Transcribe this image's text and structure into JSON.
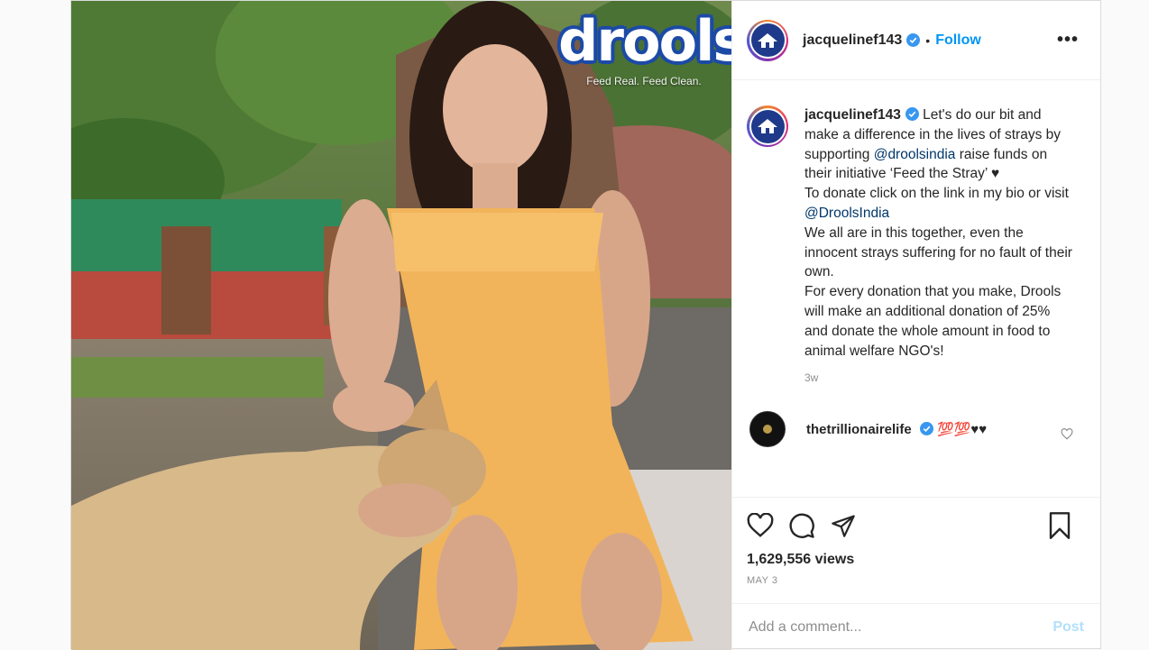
{
  "media": {
    "brand_name": "drools",
    "brand_tagline": "Feed Real. Feed Clean."
  },
  "header": {
    "username": "jacquelinef143",
    "dot": "•",
    "follow_label": "Follow",
    "more_label": "•••"
  },
  "caption": {
    "username": "jacquelinef143",
    "parts": {
      "p1": " Let's do our bit and make a difference in the lives of strays by supporting ",
      "mention1": "@droolsindia",
      "p2": " raise funds on their initiative ‘Feed the Stray’ ♥",
      "p3": "To donate click on the link in my bio or visit ",
      "mention2": "@DroolsIndia",
      "p4": "We all are in this together, even the innocent strays suffering for no fault of their own.",
      "p5": "For every donation that you make, Drools will make an additional donation of 25% and donate the whole amount in food to animal welfare NGO's!"
    },
    "time": "3w"
  },
  "reply": {
    "username": "thetrillionairelife",
    "text": "💯💯♥♥"
  },
  "footer": {
    "views": "1,629,556 views",
    "date": "MAY 3"
  },
  "comment_box": {
    "placeholder": "Add a comment...",
    "post_label": "Post"
  },
  "colors": {
    "link": "#0095f6",
    "mention": "#00376b",
    "muted": "#8e8e8e",
    "brand_blue": "#1c4aa6"
  }
}
